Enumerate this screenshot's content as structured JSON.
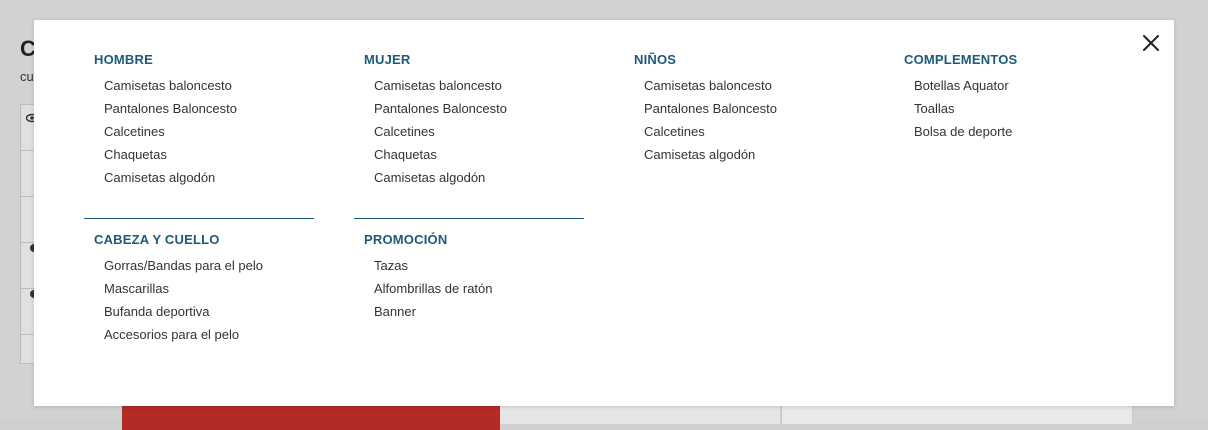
{
  "background": {
    "title": "C",
    "subtitle": "cu"
  },
  "menu": {
    "columns": [
      {
        "title": "HOMBRE",
        "items": [
          "Camisetas baloncesto",
          "Pantalones Baloncesto",
          "Calcetines",
          "Chaquetas",
          "Camisetas algodón"
        ]
      },
      {
        "title": "MUJER",
        "items": [
          "Camisetas baloncesto",
          "Pantalones Baloncesto",
          "Calcetines",
          "Chaquetas",
          "Camisetas algodón"
        ]
      },
      {
        "title": "NIÑOS",
        "items": [
          "Camisetas baloncesto",
          "Pantalones Baloncesto",
          "Calcetines",
          "Camisetas algodón"
        ]
      },
      {
        "title": "COMPLEMENTOS",
        "items": [
          "Botellas Aquator",
          "Toallas",
          "Bolsa de deporte"
        ]
      },
      {
        "title": "CABEZA Y CUELLO",
        "items": [
          "Gorras/Bandas para el pelo",
          "Mascarillas",
          "Bufanda deportiva",
          "Accesorios para el pelo"
        ]
      },
      {
        "title": "PROMOCIÓN",
        "items": [
          "Tazas",
          "Alfombrillas de ratón",
          "Banner"
        ]
      }
    ],
    "close_icon": "close-icon",
    "accent_color": "#1d5a7a"
  }
}
